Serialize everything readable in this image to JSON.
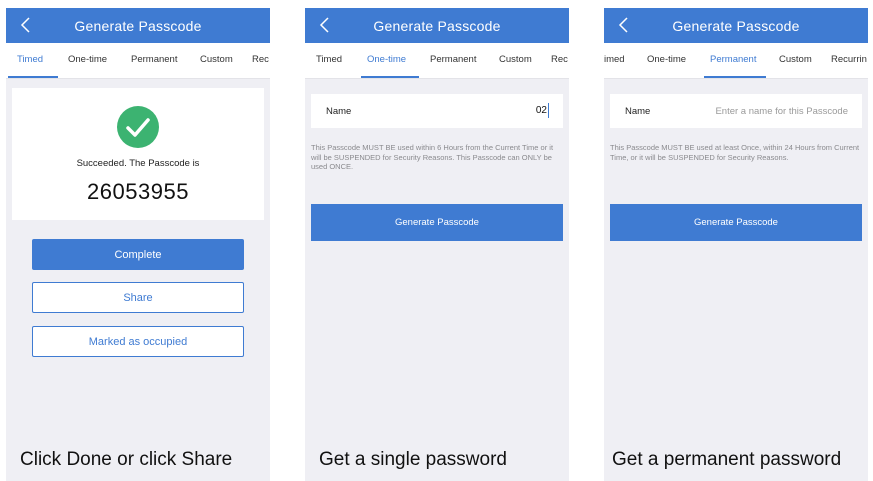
{
  "screens": [
    {
      "title": "Generate Passcode",
      "tabs": [
        "Timed",
        "One-time",
        "Permanent",
        "Custom",
        "Rec"
      ],
      "active_tab": "Timed",
      "success_text": "Succeeded. The Passcode is",
      "passcode": "26053955",
      "complete_label": "Complete",
      "share_label": "Share",
      "occupied_label": "Marked as occupied"
    },
    {
      "title": "Generate Passcode",
      "tabs": [
        "Timed",
        "One-time",
        "Permanent",
        "Custom",
        "Rec"
      ],
      "active_tab": "One-time",
      "name_label": "Name",
      "name_value": "02",
      "hint": "This Passcode MUST BE used within 6 Hours from the Current Time or it will be SUSPENDED for Security Reasons. This Passcode can ONLY be used ONCE.",
      "generate_label": "Generate Passcode"
    },
    {
      "title": "Generate Passcode",
      "tabs": [
        "imed",
        "One-time",
        "Permanent",
        "Custom",
        "Recurrin"
      ],
      "active_tab": "Permanent",
      "name_label": "Name",
      "name_placeholder": "Enter a name for this Passcode",
      "hint": "This Passcode MUST BE used at least Once, within 24 Hours from Current Time, or it will be SUSPENDED for Security Reasons.",
      "generate_label": "Generate Passcode"
    }
  ],
  "captions": [
    "Click Done or click Share",
    "Get a single password",
    "Get a permanent password"
  ],
  "colors": {
    "primary": "#3f7bd2",
    "success": "#3cb371",
    "background": "#efeff4"
  },
  "icons": {
    "back": "chevron-left-icon",
    "success": "checkmark-circle-icon"
  }
}
